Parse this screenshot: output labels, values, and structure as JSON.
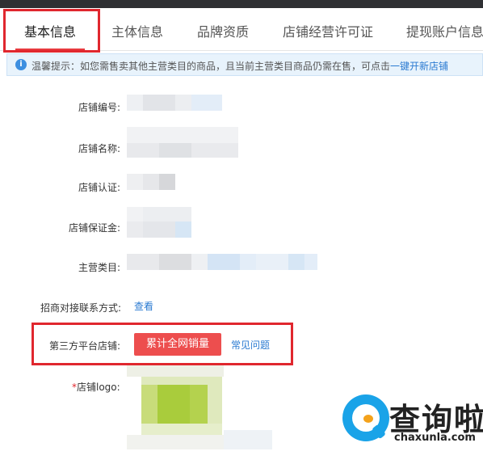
{
  "tabs": [
    {
      "label": "基本信息"
    },
    {
      "label": "主体信息"
    },
    {
      "label": "品牌资质"
    },
    {
      "label": "店铺经营许可证"
    },
    {
      "label": "提现账户信息"
    }
  ],
  "tip": {
    "text": "温馨提示：如您需售卖其他主营类目的商品，且当前主营类目商品仍需在售，可点击",
    "link": "一键开新店铺"
  },
  "fields": {
    "shop_id_label": "店铺编号:",
    "shop_name_label": "店铺名称:",
    "shop_cert_label": "店铺认证:",
    "shop_deposit_label": "店铺保证金:",
    "main_category_label": "主营类目:",
    "contact_label": "招商对接联系方式:",
    "contact_link": "查看",
    "third_party_label": "第三方平台店铺:",
    "sales_button": "累计全网销量",
    "faq_link": "常见问题",
    "logo_label": "店铺logo:",
    "logo_required_mark": "*"
  },
  "watermark": {
    "title": "查询啦",
    "url": "chaxunla.com"
  },
  "colors": {
    "accent_red": "#ed4e4e",
    "highlight_red": "#e0272e",
    "link_blue": "#2a7ad1",
    "tip_bg": "#e8f3fc",
    "logo_green": "#a9cc3c"
  }
}
